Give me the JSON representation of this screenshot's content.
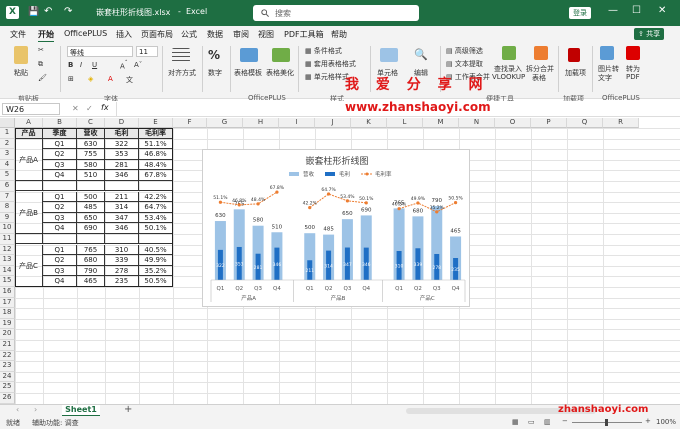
{
  "titlebar": {
    "filename": "嵌套柱形折线图.xlsx",
    "app": "Excel",
    "search_placeholder": "搜索",
    "login": "登录",
    "autosave_label": "自动保存"
  },
  "menu": [
    "文件",
    "开始",
    "OfficePLUS",
    "插入",
    "页面布局",
    "公式",
    "数据",
    "审阅",
    "视图",
    "PDF工具箱",
    "帮助"
  ],
  "share_label": "共享",
  "ribbon": {
    "paste": "粘贴",
    "clipboard": "剪贴板",
    "font_name": "等线",
    "font_size": "11",
    "font_group": "字体",
    "align": "对齐方式",
    "number": "数字",
    "table_template": "表格模板",
    "table_beautify": "表格美化",
    "officeplus_group": "OfficePLUS",
    "cond_format": "条件格式",
    "use_table_format": "套用表格格式",
    "cell_style": "单元格样式",
    "style_group": "样式",
    "cells": "单元格",
    "edit": "编辑",
    "advanced_filter": "高级筛选",
    "text_extract": "文本提取",
    "worksheet_merge": "工作表合并",
    "lookup": "查找录入",
    "vlookup": "VLOOKUP",
    "split_merge": "拆分合并",
    "table": "表格",
    "convenient_group": "便捷工具",
    "addins": "加载项",
    "addins_group": "加载项",
    "img_convert": "图片转",
    "text": "文字",
    "to_pdf": "转为",
    "pdf": "PDF",
    "officeplus_group2": "OfficePLUS"
  },
  "watermark_top": "我 爱 分 享 网",
  "watermark_url": "www.zhanshaoyi.com",
  "watermark_bottom": "zhanshaoyi.com",
  "formula": {
    "namebox": "W26",
    "fx": "fx"
  },
  "columns": [
    "A",
    "B",
    "C",
    "D",
    "E",
    "F",
    "G",
    "H",
    "I",
    "J",
    "K",
    "L",
    "M",
    "N",
    "O",
    "P",
    "Q",
    "R"
  ],
  "rows": [
    "1",
    "2",
    "3",
    "4",
    "5",
    "6",
    "7",
    "8",
    "9",
    "10",
    "11",
    "12",
    "13",
    "14",
    "15",
    "16",
    "17",
    "18",
    "19",
    "20",
    "21",
    "22",
    "23",
    "24",
    "25",
    "26"
  ],
  "table": {
    "headers": [
      "产品",
      "季度",
      "营收",
      "毛利",
      "毛利率"
    ],
    "groups": [
      {
        "name": "产品A",
        "rows": [
          [
            "Q1",
            "630",
            "322",
            "51.1%"
          ],
          [
            "Q2",
            "755",
            "353",
            "46.8%"
          ],
          [
            "Q3",
            "580",
            "281",
            "48.4%"
          ],
          [
            "Q4",
            "510",
            "346",
            "67.8%"
          ]
        ]
      },
      {
        "name": "产品B",
        "rows": [
          [
            "Q1",
            "500",
            "211",
            "42.2%"
          ],
          [
            "Q2",
            "485",
            "314",
            "64.7%"
          ],
          [
            "Q3",
            "650",
            "347",
            "53.4%"
          ],
          [
            "Q4",
            "690",
            "346",
            "50.1%"
          ]
        ]
      },
      {
        "name": "产品C",
        "rows": [
          [
            "Q1",
            "765",
            "310",
            "40.5%"
          ],
          [
            "Q2",
            "680",
            "339",
            "49.9%"
          ],
          [
            "Q3",
            "790",
            "278",
            "35.2%"
          ],
          [
            "Q4",
            "465",
            "235",
            "50.5%"
          ]
        ]
      }
    ]
  },
  "chart_data": {
    "type": "bar",
    "title": "嵌套柱形折线图",
    "categories": [
      "Q1",
      "Q2",
      "Q3",
      "Q4",
      "Q1",
      "Q2",
      "Q3",
      "Q4",
      "Q1",
      "Q2",
      "Q3",
      "Q4"
    ],
    "groups": [
      "产品A",
      "产品B",
      "产品C"
    ],
    "series": [
      {
        "name": "营收",
        "type": "bar",
        "color": "#9dc3e6",
        "values": [
          630,
          755,
          580,
          510,
          500,
          485,
          650,
          690,
          765,
          680,
          790,
          465
        ]
      },
      {
        "name": "毛利",
        "type": "bar",
        "color": "#1f6fc5",
        "values": [
          322,
          353,
          281,
          346,
          211,
          314,
          347,
          346,
          310,
          339,
          278,
          235
        ]
      },
      {
        "name": "毛利率",
        "type": "line",
        "color": "#ed7d31",
        "values": [
          51.1,
          46.8,
          48.4,
          67.8,
          42.2,
          64.7,
          53.4,
          50.1,
          40.5,
          49.9,
          35.2,
          50.5
        ],
        "labels": [
          "51.1%",
          "46.8%",
          "48.4%",
          "67.8%",
          "42.2%",
          "64.7%",
          "53.4%",
          "50.1%",
          "40.5%",
          "49.9%",
          "35.2%",
          "50.5%"
        ]
      }
    ],
    "legend_position": "top"
  },
  "sheet_tab": "Sheet1",
  "status": {
    "ready": "就绪",
    "accessibility": "辅助功能: 调查",
    "zoom": "100%"
  }
}
